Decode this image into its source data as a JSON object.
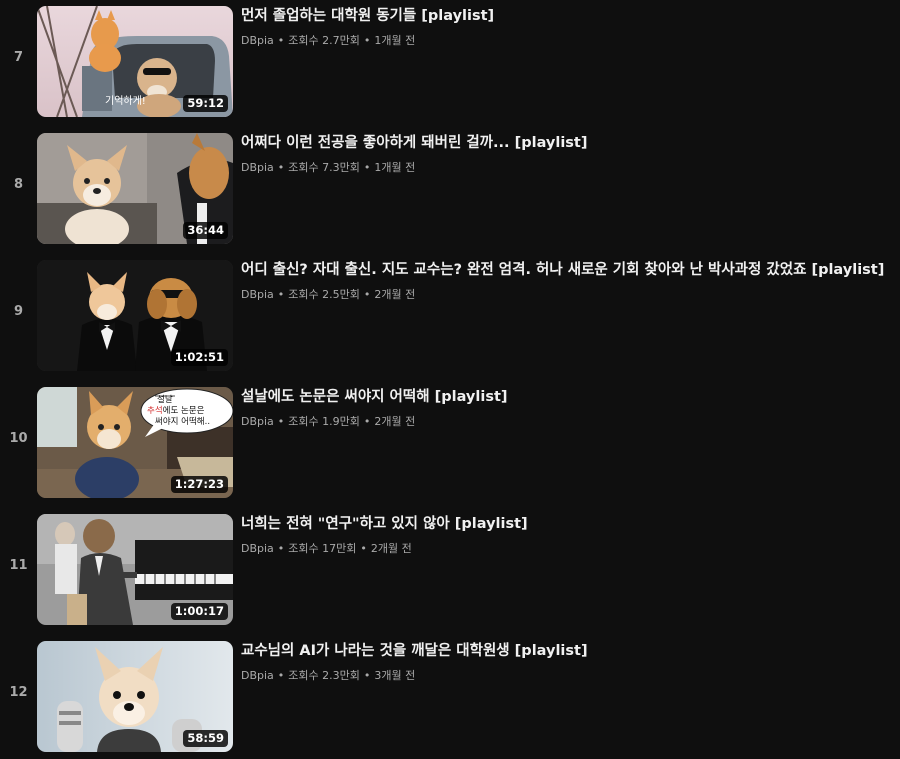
{
  "colors": {
    "background": "#0f0f0f",
    "title_text": "#f1f1f1",
    "meta_text": "#aaaaaa",
    "duration_bg": "#000000"
  },
  "items": [
    {
      "index": "7",
      "title": "먼저 졸업하는 대학원 동기들 [playlist]",
      "channel": "DBpia",
      "sep1": "•",
      "views": "조회수 2.7만회",
      "sep2": "•",
      "age": "1개월 전",
      "duration": "59:12",
      "thumb_caption": "기억하게!"
    },
    {
      "index": "8",
      "title": "어쩌다 이런 전공을 좋아하게 돼버린 걸까... [playlist]",
      "channel": "DBpia",
      "sep1": "•",
      "views": "조회수 7.3만회",
      "sep2": "•",
      "age": "1개월 전",
      "duration": "36:44"
    },
    {
      "index": "9",
      "title": "어디 출신? 자대 출신. 지도 교수는? 완전 엄격. 허나 새로운 기회 찾아와 난 박사과정 갔었죠 [playlist]",
      "channel": "DBpia",
      "sep1": "•",
      "views": "조회수 2.5만회",
      "sep2": "•",
      "age": "2개월 전",
      "duration": "1:02:51"
    },
    {
      "index": "10",
      "title": "설날에도 논문은 써야지 어떡해 [playlist]",
      "channel": "DBpia",
      "sep1": "•",
      "views": "조회수 1.9만회",
      "sep2": "•",
      "age": "2개월 전",
      "duration": "1:27:23",
      "bubble_line1": "설날",
      "bubble_line2a": "추석",
      "bubble_line2b": "에도 논문은",
      "bubble_line3": "써야지 어떡해.."
    },
    {
      "index": "11",
      "title": "너희는 전혀 \"연구\"하고 있지 않아 [playlist]",
      "channel": "DBpia",
      "sep1": "•",
      "views": "조회수 17만회",
      "sep2": "•",
      "age": "2개월 전",
      "duration": "1:00:17"
    },
    {
      "index": "12",
      "title": "교수님의 AI가 나라는 것을 깨달은 대학원생 [playlist]",
      "channel": "DBpia",
      "sep1": "•",
      "views": "조회수 2.3만회",
      "sep2": "•",
      "age": "3개월 전",
      "duration": "58:59"
    }
  ]
}
